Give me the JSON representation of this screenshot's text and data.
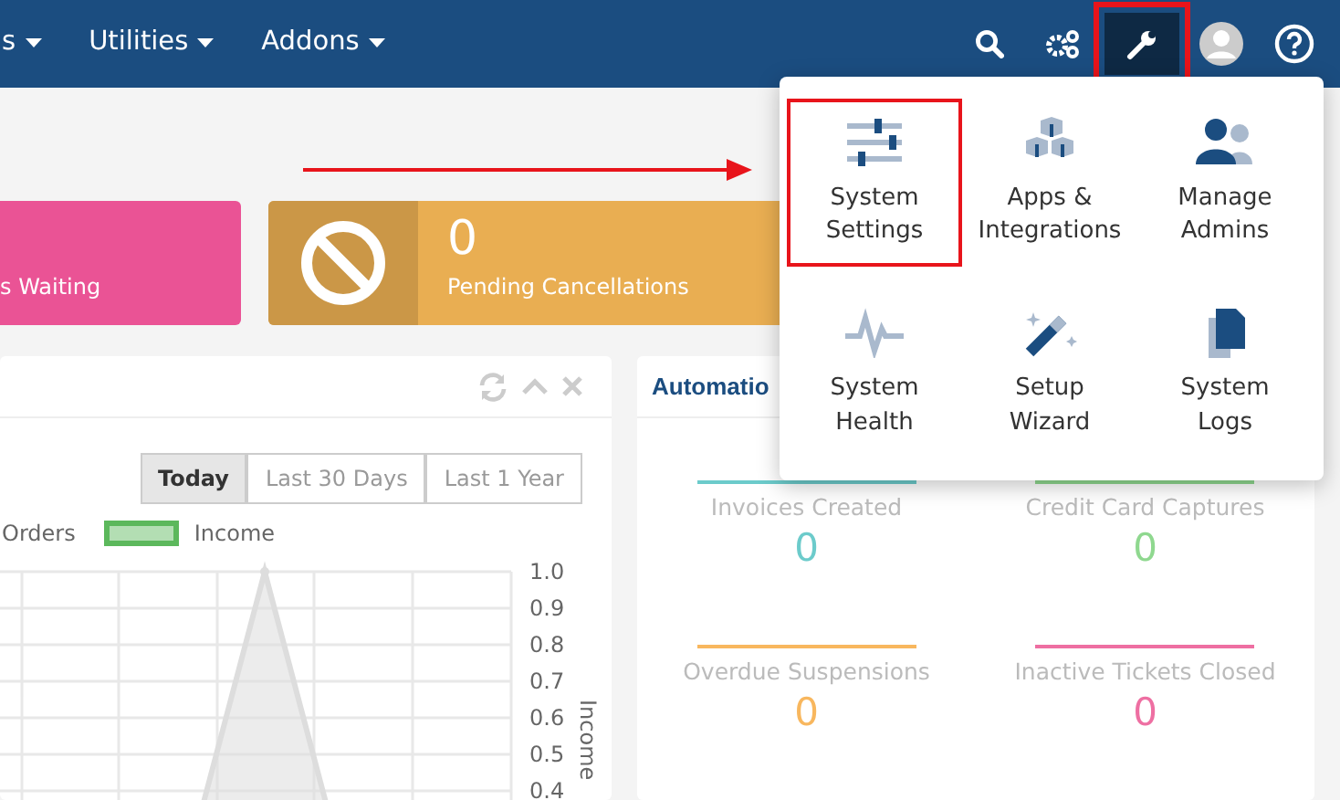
{
  "navbar": {
    "menus": [
      {
        "label": "s"
      },
      {
        "label": "Utilities"
      },
      {
        "label": "Addons"
      }
    ],
    "tools": [
      {
        "kind": "search",
        "active": false,
        "highlighted": false
      },
      {
        "kind": "gears",
        "active": false,
        "highlighted": false
      },
      {
        "kind": "wrench",
        "active": true,
        "highlighted": true
      },
      {
        "kind": "avatar",
        "active": false,
        "highlighted": false
      },
      {
        "kind": "help",
        "active": false,
        "highlighted": false
      }
    ]
  },
  "stat_cards": [
    {
      "label": "s Waiting",
      "color": "#ea5395"
    },
    {
      "value": "0",
      "label": "Pending Cancellations",
      "color": "#e9ae52"
    }
  ],
  "chart_panel": {
    "range_buttons": [
      {
        "label": "Today",
        "selected": true
      },
      {
        "label": "Last 30 Days",
        "selected": false
      },
      {
        "label": "Last 1 Year",
        "selected": false
      }
    ],
    "legend": [
      {
        "label": "Orders"
      },
      {
        "label": "Income",
        "color": "#5cb85c"
      }
    ],
    "chart_data": {
      "type": "area",
      "ylabel": "Income",
      "ylim": [
        0,
        1
      ],
      "grid": true,
      "yticks": [
        0.4,
        0.5,
        0.6,
        0.7,
        0.8,
        0.9,
        {
          "value": 1,
          "label": "1.0"
        }
      ],
      "series": [
        {
          "color": "#dddddd",
          "values": [
            0,
            0,
            1,
            0,
            0
          ]
        }
      ]
    }
  },
  "automation_panel": {
    "title": "Automatio",
    "stats": [
      {
        "label": "Invoices Created",
        "value": "0",
        "color": "#6ccbcb"
      },
      {
        "label": "Credit Card Captures",
        "value": "0",
        "color": "#8fd88f"
      },
      {
        "label": "Overdue Suspensions",
        "value": "0",
        "color": "#f8b75e"
      },
      {
        "label": "Inactive Tickets Closed",
        "value": "0",
        "color": "#ee6fa2"
      }
    ]
  },
  "tools_menu": {
    "items": [
      {
        "kind": "settings",
        "label": "System Settings",
        "highlighted": true
      },
      {
        "kind": "apps",
        "label": "Apps & Integrations",
        "highlighted": false
      },
      {
        "kind": "admins",
        "label": "Manage Admins",
        "highlighted": false
      },
      {
        "kind": "health",
        "label": "System Health",
        "highlighted": false
      },
      {
        "kind": "wizard",
        "label": "Setup Wizard",
        "highlighted": false
      },
      {
        "kind": "logs",
        "label": "System Logs",
        "highlighted": false
      }
    ]
  }
}
